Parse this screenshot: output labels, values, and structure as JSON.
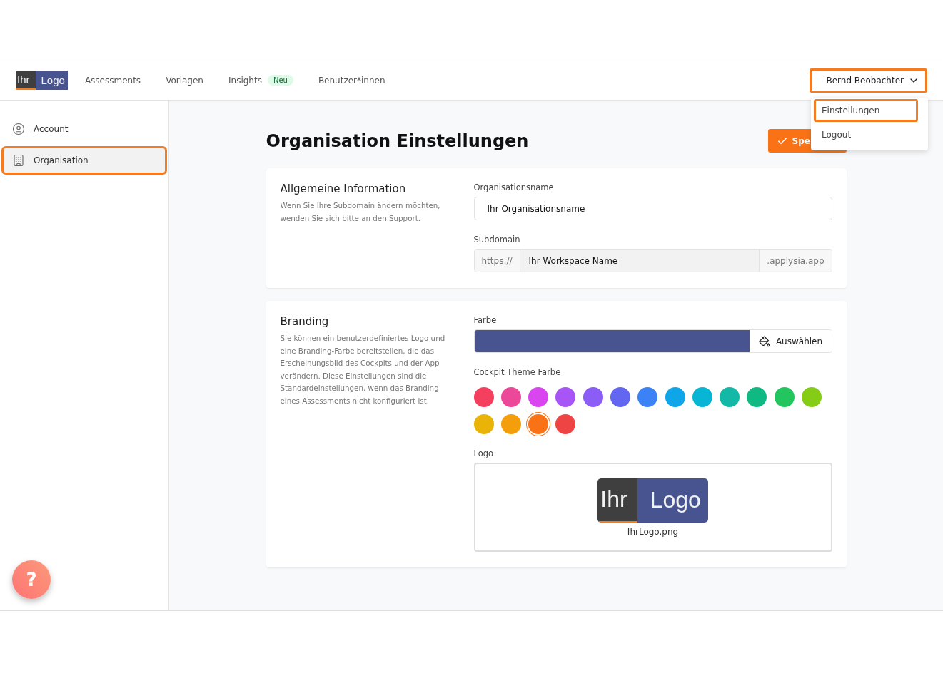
{
  "header": {
    "logo": {
      "left": "Ihr",
      "right": "Logo"
    },
    "nav": [
      {
        "label": "Assessments"
      },
      {
        "label": "Vorlagen"
      },
      {
        "label": "Insights",
        "badge": "Neu"
      },
      {
        "label": "Benutzer*innen"
      }
    ],
    "user_menu": {
      "label": "Bernd Beobachter",
      "highlighted": true,
      "expanded": true,
      "items": [
        {
          "label": "Einstellungen",
          "highlighted": true
        },
        {
          "label": "Logout",
          "highlighted": false
        }
      ]
    }
  },
  "sidebar": {
    "items": [
      {
        "label": "Account",
        "kind": "account",
        "selected": false,
        "highlighted": false
      },
      {
        "label": "Organisation",
        "kind": "organisation",
        "selected": true,
        "highlighted": true
      }
    ]
  },
  "page": {
    "title": "Organisation Einstellungen",
    "save_button": "Spe"
  },
  "general": {
    "title": "Allgemeine Information",
    "description": "Wenn Sie Ihre Subdomain ändern möchten, wenden Sie sich bitte an den Support.",
    "org_name_label": "Organisationsname",
    "org_name_value": "Ihr Organisationsname",
    "subdomain_label": "Subdomain",
    "subdomain_prefix": "https://",
    "subdomain_value": "Ihr Workspace Name",
    "subdomain_suffix": ".applysia.app"
  },
  "branding": {
    "title": "Branding",
    "description": "Sie können ein benutzerdefiniertes Logo und eine Branding-Farbe bereitstellen, die das Erscheinungsbild des Cockpits und der App verändern. Diese Einstellungen sind die Standardeinstellungen, wenn das Branding eines Assessments nicht konfiguriert ist.",
    "color_label": "Farbe",
    "color": "#47548f",
    "choose_button": "Auswählen",
    "theme_label": "Cockpit Theme Farbe",
    "theme_colors": [
      {
        "color": "#f43f5e",
        "selected": false
      },
      {
        "color": "#ec4899",
        "selected": false
      },
      {
        "color": "#d946ef",
        "selected": false
      },
      {
        "color": "#a855f7",
        "selected": false
      },
      {
        "color": "#8b5cf6",
        "selected": false
      },
      {
        "color": "#6366f1",
        "selected": false
      },
      {
        "color": "#3b82f6",
        "selected": false
      },
      {
        "color": "#0ea5e9",
        "selected": false
      },
      {
        "color": "#06b6d4",
        "selected": false
      },
      {
        "color": "#14b8a6",
        "selected": false
      },
      {
        "color": "#10b981",
        "selected": false
      },
      {
        "color": "#22c55e",
        "selected": false
      },
      {
        "color": "#84cc16",
        "selected": false
      },
      {
        "color": "#eab308",
        "selected": false
      },
      {
        "color": "#f59e0b",
        "selected": false
      },
      {
        "color": "#f97316",
        "selected": true
      },
      {
        "color": "#ef4444",
        "selected": false
      }
    ],
    "logo_label": "Logo",
    "logo": {
      "left": "Ihr",
      "right": "Logo"
    },
    "logo_file": "IhrLogo.png"
  },
  "help_button": "?"
}
